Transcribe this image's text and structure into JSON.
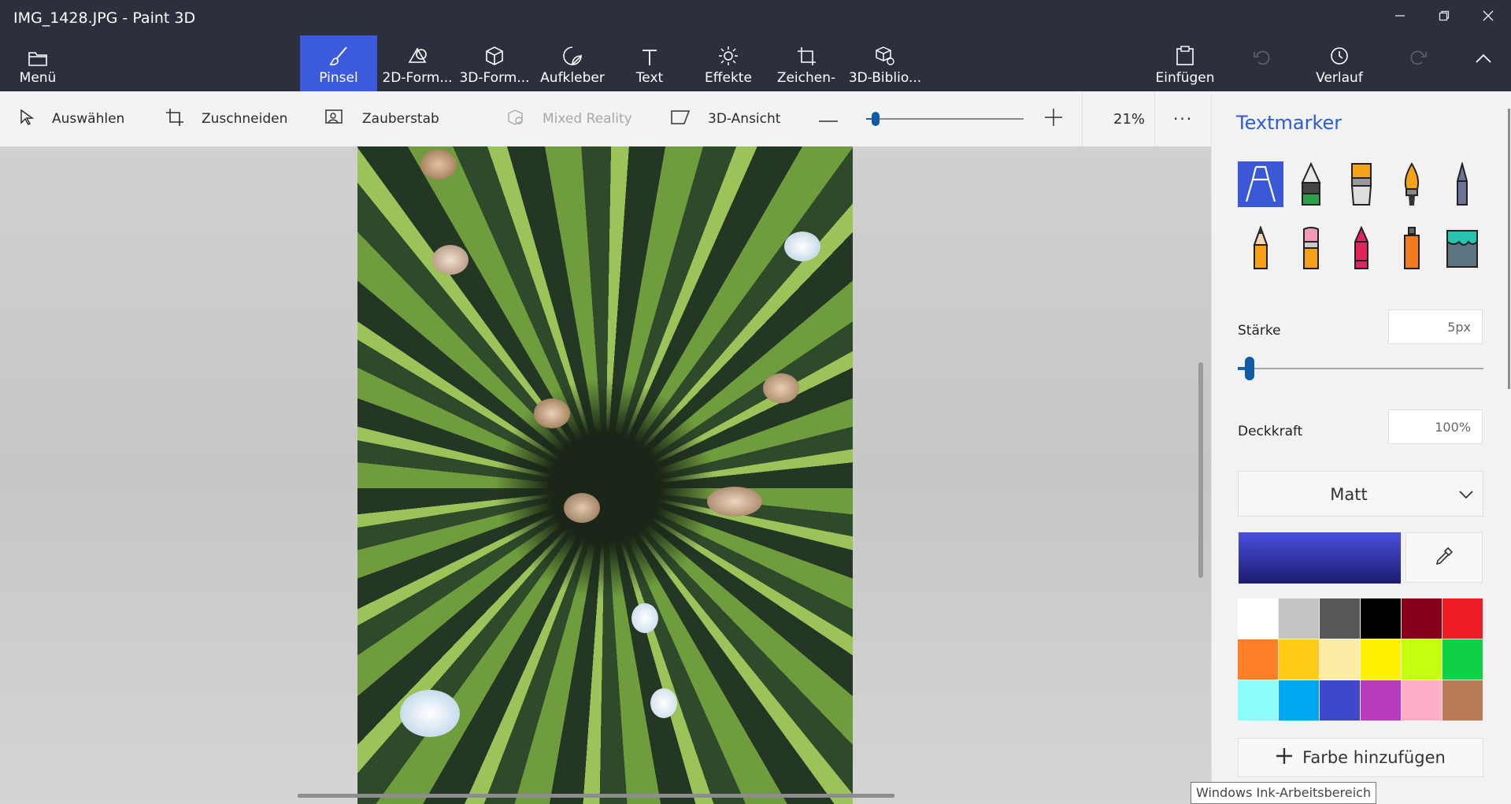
{
  "window": {
    "title": "IMG_1428.JPG - Paint 3D",
    "controls": {
      "minimize_icon": "minimize-icon",
      "restore_icon": "restore-icon",
      "close_icon": "close-icon"
    }
  },
  "ribbon": {
    "menu_label": "Menü",
    "tools": [
      {
        "label": "Pinsel",
        "icon": "brush-icon",
        "active": true
      },
      {
        "label": "2D-Form...",
        "icon": "2d-shapes-icon"
      },
      {
        "label": "3D-Form...",
        "icon": "3d-shapes-icon"
      },
      {
        "label": "Aufkleber",
        "icon": "sticker-icon"
      },
      {
        "label": "Text",
        "icon": "text-icon"
      },
      {
        "label": "Effekte",
        "icon": "effects-icon"
      },
      {
        "label": "Zeichen-",
        "icon": "canvas-icon"
      },
      {
        "label": "3D-Biblio...",
        "icon": "3d-library-icon"
      }
    ],
    "paste_label": "Einfügen",
    "history_label": "Verlauf"
  },
  "toolbar": {
    "select_label": "Auswählen",
    "crop_label": "Zuschneiden",
    "magic_select_label": "Zauberstab",
    "mixed_reality_label": "Mixed Reality",
    "view_3d_label": "3D-Ansicht",
    "zoom_level": "21%",
    "zoom_fraction": 0.02,
    "more_icon": "more-icon"
  },
  "panel": {
    "title": "Textmarker",
    "brushes": [
      {
        "name": "marker",
        "selected": true
      },
      {
        "name": "calligraphy-pen"
      },
      {
        "name": "oil-brush"
      },
      {
        "name": "watercolor"
      },
      {
        "name": "pixel-pen"
      },
      {
        "name": "pencil"
      },
      {
        "name": "eraser"
      },
      {
        "name": "crayon"
      },
      {
        "name": "spray-can"
      },
      {
        "name": "fill"
      }
    ],
    "thickness_label": "Stärke",
    "thickness_value": "5px",
    "thickness_fraction": 0.03,
    "opacity_label": "Deckkraft",
    "opacity_value": "100%",
    "finish": "Matt",
    "current_color_from": "#4a4fe0",
    "current_color_to": "#1c1d6e",
    "palette": [
      "#ffffff",
      "#c3c3c3",
      "#585858",
      "#000000",
      "#88001b",
      "#ec1c24",
      "#ff7f27",
      "#ffca18",
      "#fdeca6",
      "#fff200",
      "#c4ff0e",
      "#0ed145",
      "#8cfffb",
      "#00a8f3",
      "#3f48cc",
      "#b83dba",
      "#ffaec8",
      "#b97a56"
    ],
    "add_color_label": "Farbe hinzufügen"
  },
  "tooltip": "Windows Ink-Arbeitsbereich",
  "accent": "#3a57d6"
}
